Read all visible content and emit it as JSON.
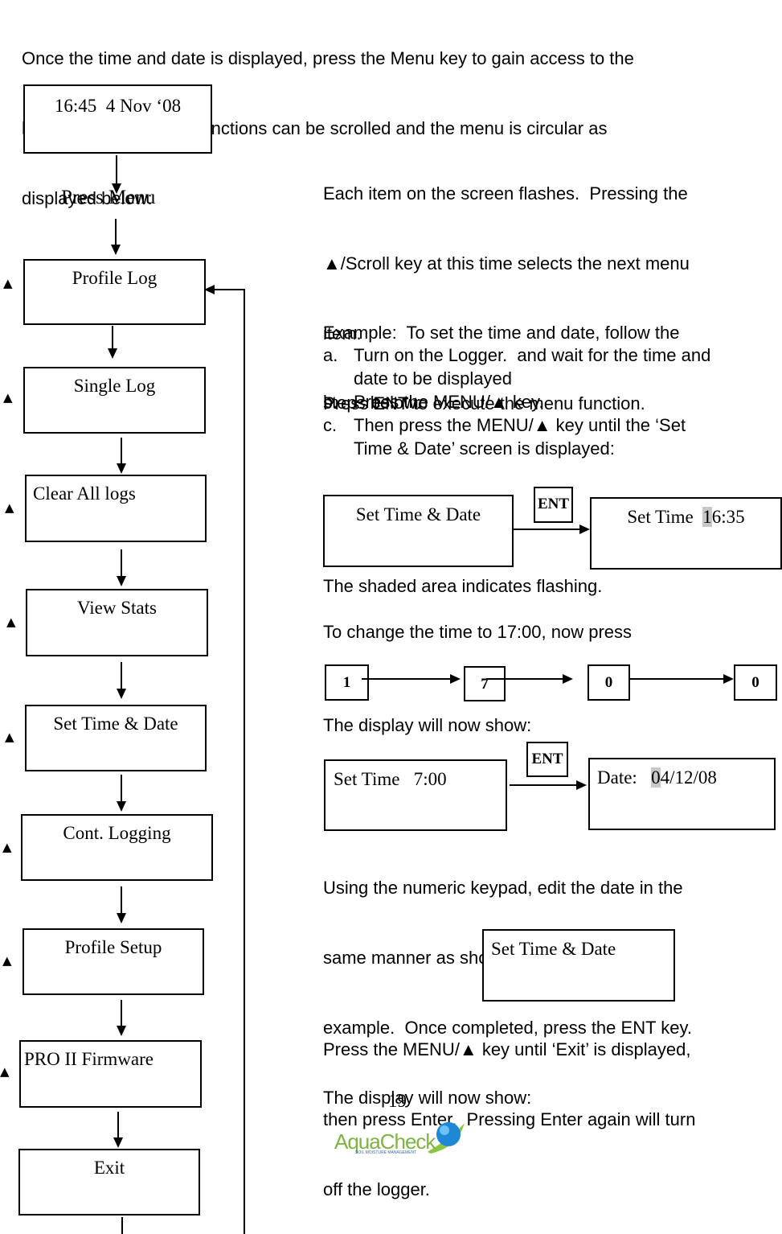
{
  "intro": {
    "lines": [
      "Once the time and date is displayed, press the Menu key to gain access to the",
      "logger functions.  The functions can be scrolled and the menu is circular as",
      "displayed below:"
    ]
  },
  "flowchart": {
    "start_display": "16:45  4 Nov ‘08",
    "press_menu_label": "Press Menu",
    "scroll_marker": "▲",
    "menu_items": [
      "Profile Log",
      "Single Log",
      "Clear All logs",
      "View Stats",
      "Set Time & Date",
      "Cont. Logging",
      "Profile Setup",
      "PRO II Firmware",
      "Exit"
    ]
  },
  "explanation": {
    "lines": [
      "Each item on the screen flashes.  Pressing the",
      "▲/Scroll key at this time selects the next menu",
      "item.",
      "Press ENT to execute the menu function."
    ]
  },
  "example": {
    "intro_lines": [
      "Example:  To set the time and date, follow the",
      "steps below:"
    ],
    "steps": [
      {
        "marker": "a.",
        "lines": [
          "Turn on the Logger.  and wait for the time and",
          "date to be displayed"
        ]
      },
      {
        "marker": "b.",
        "lines": [
          "Press the MENU/▲ key."
        ]
      },
      {
        "marker": "c.",
        "lines": [
          "Then press the MENU/▲ key until the ‘Set",
          "Time & Date’ screen is displayed:"
        ]
      }
    ],
    "screen1": "Set Time & Date",
    "ent_key": "ENT",
    "screen2_prefix": "Set Time  ",
    "screen2_flash": "1",
    "screen2_suffix": "6:35",
    "shaded_note": "The shaded area indicates flashing.",
    "change_note": "To change the time to 17:00, now press",
    "keys": [
      "1",
      "7",
      "0",
      "0"
    ],
    "display_now": "The display will now show:",
    "screen3": "Set Time   7:00",
    "screen4_prefix": "Date:   ",
    "screen4_flash": "0",
    "screen4_suffix": "4/12/08",
    "date_lines": [
      "Using the numeric keypad, edit the date in the",
      "same manner as shown in the time setting",
      "example.  Once completed, press the ENT key.",
      "The display will now show:"
    ],
    "screen5": "Set Time & Date",
    "exit_lines": [
      "Press the MENU/▲ key until ‘Exit’ is displayed,",
      "then press Enter.  Pressing Enter again will turn",
      "off the logger."
    ]
  },
  "footer": {
    "page_number": "19",
    "logo_text": "AquaCheck",
    "logo_tagline": "SOIL MOISTURE MANAGEMENT"
  }
}
